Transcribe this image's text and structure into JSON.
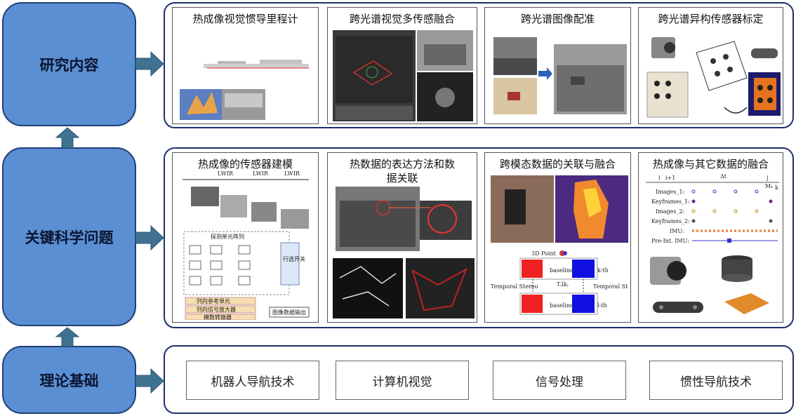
{
  "levels": {
    "research": "研究内容",
    "key": "关键科学问题",
    "theory": "理论基础"
  },
  "research_cards": [
    "热成像视觉惯导里程计",
    "跨光谱视觉多传感融合",
    "跨光谱图像配准",
    "跨光谱异构传感器标定"
  ],
  "key_cards": [
    "热成像的传感器建模",
    "热数据的表达方法和数据关联",
    "跨模态数据的关联与融合",
    "热成像与其它数据的融合"
  ],
  "foundations": [
    "机器人导航技术",
    "计算机视觉",
    "信号处理",
    "惯性导航技术"
  ],
  "sensor_model": {
    "block_title": "探测单元阵列",
    "select_switch": "行选开关",
    "ref_unit": "列向参考单元",
    "signal_amp": "列向信号放大器",
    "adc": "模数转换器",
    "output": "图像数据输出",
    "lwir_labels": [
      "LWIR",
      "LWIR",
      "LWIR"
    ]
  },
  "stereo_diagram": {
    "point": "3D Point",
    "baseline_top": "baseline",
    "baseline_bottom": "baseline",
    "kth": "k-th",
    "lth": "l-th",
    "temporal_left": "Temporal Stereo",
    "temporal_right": "Temporal Stereo",
    "t_label": "T₍lk₎"
  },
  "timeline": {
    "rows": [
      "Images_1:",
      "Keyframes_1:",
      "Images_2:",
      "Keyframes_2:",
      "IMU:",
      "Pre-Int. IMU:"
    ],
    "tick_i": "i",
    "tick_i1": "i+1",
    "tick_j": "j",
    "tick_k": "k",
    "delta": "Δt",
    "mk": "Mₖ"
  },
  "colors": {
    "left_fill": "#5b8fd3",
    "left_border": "#1e3f78",
    "arrow": "#3f7191",
    "panel_border": "#1e2f6e"
  }
}
